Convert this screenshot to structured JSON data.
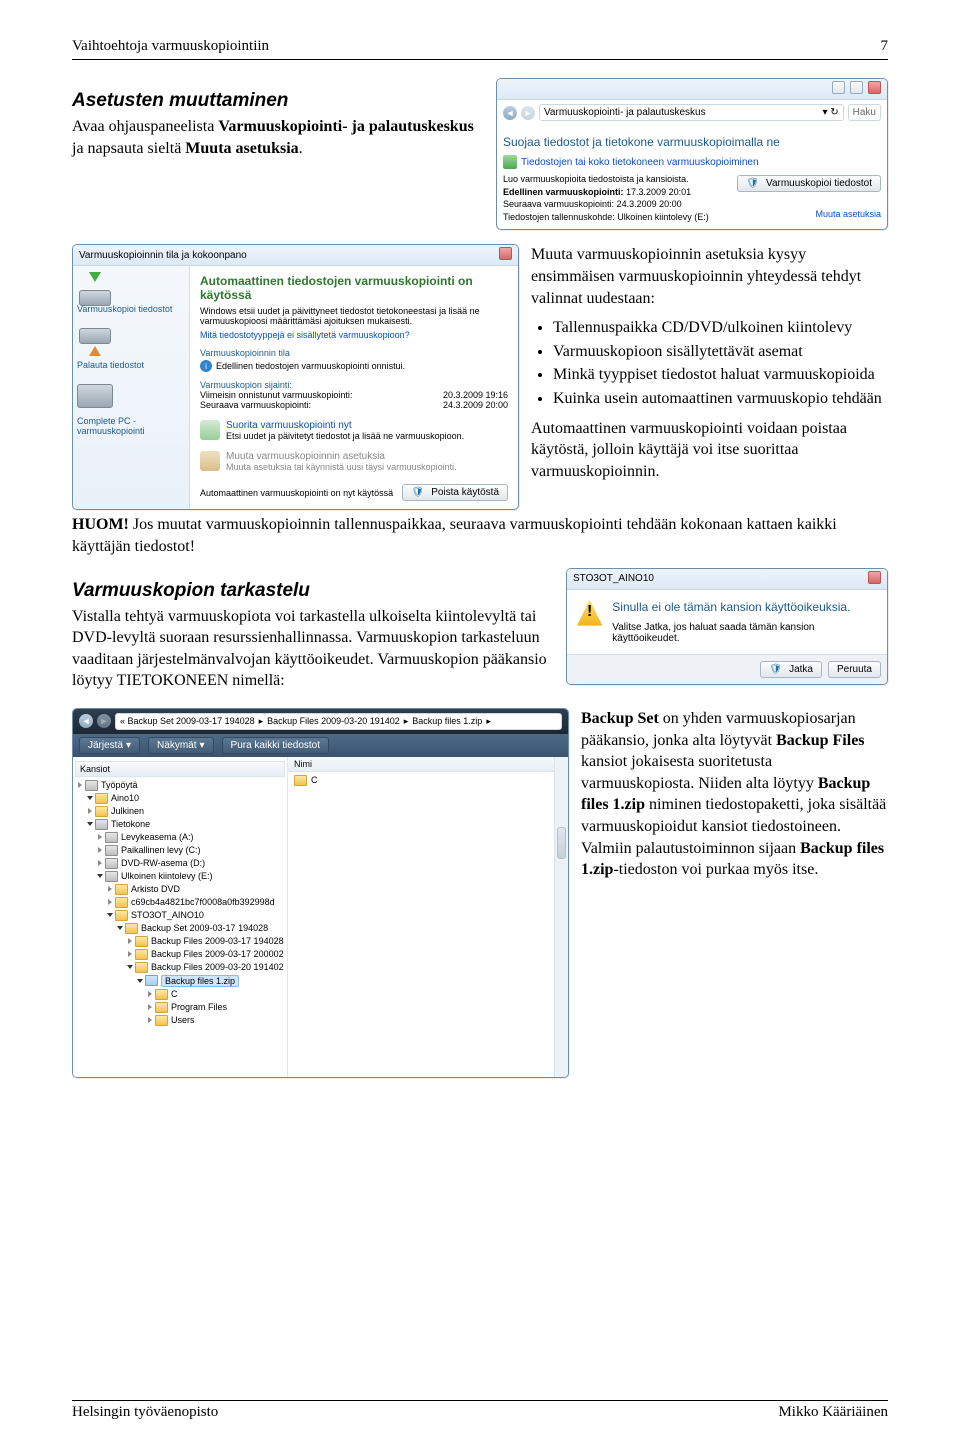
{
  "header": {
    "left": "Vaihtoehtoja varmuuskopiointiin",
    "right": "7"
  },
  "section1": {
    "title": "Asetusten muuttaminen",
    "p1a": "Avaa ohjauspaneelista ",
    "p1b": "Varmuuskopiointi- ja palautuskeskus",
    "p1c": " ja napsauta sieltä ",
    "p1d": "Muuta asetuksia",
    "p1e": "."
  },
  "panelA": {
    "crumb": "Varmuuskopiointi- ja palautuskeskus",
    "search": "Haku",
    "heading": "Suojaa tiedostot ja tietokone varmuuskopioimalla ne",
    "link1": "Tiedostojen tai koko tietokoneen varmuuskopioiminen",
    "desc": "Luo varmuuskopioita tiedostoista ja kansioista.",
    "btn": "Varmuuskopioi tiedostot",
    "row1a": "Edellinen varmuuskopiointi:",
    "row1b": "17.3.2009 20:01",
    "row2a": "Seuraava varmuuskopiointi:",
    "row2b": "24.3.2009 20:00",
    "row3a": "Tiedostojen tallennuskohde:",
    "row3b": "Ulkoinen kiintolevy (E:)",
    "link2": "Muuta asetuksia"
  },
  "panelB": {
    "title": "Varmuuskopioinnin tila ja kokoonpano",
    "side1": "Varmuuskopioi tiedostot",
    "side2": "Palauta tiedostot",
    "side3": "Complete PC -varmuuskopiointi",
    "h1": "Automaattinen tiedostojen varmuuskopiointi on käytössä",
    "d1": "Windows etsii uudet ja päivittyneet tiedostot tietokoneestasi ja lisää ne varmuuskopioosi määrittämäsi ajoituksen mukaisesti.",
    "q1": "Mitä tiedostotyyppejä ei sisällytetä varmuuskopioon?",
    "s1": "Varmuuskopioinnin tila",
    "ok": "Edellinen tiedostojen varmuuskopiointi onnistui.",
    "s2": "Varmuuskopion sijainti:",
    "r1a": "Viimeisin onnistunut varmuuskopiointi:",
    "r1b": "20.3.2009 19:16",
    "r2a": "Seuraava varmuuskopiointi:",
    "r2b": "24.3.2009 20:00",
    "run": "Suorita varmuuskopiointi nyt",
    "rund": "Etsi uudet ja päivitetyt tiedostot ja lisää ne varmuuskopioon.",
    "chg": "Muuta varmuuskopioinnin asetuksia",
    "chgd": "Muuta asetuksia tai käynnistä uusi täysi varmuuskopiointi.",
    "stat": "Automaattinen varmuuskopiointi on nyt käytössä",
    "off": "Poista käytöstä"
  },
  "rightText": {
    "p0": "Muuta varmuuskopioinnin asetuksia kysyy ensimmäisen varmuuskopioinnin yhteydessä tehdyt valinnat uudestaan:",
    "li": [
      "Tallennuspaikka CD/DVD/ulkoinen kiintolevy",
      "Varmuuskopioon sisällytettävät asemat",
      "Minkä tyyppiset tiedostot haluat varmuuskopioida",
      "Kuinka usein automaattinen varmuuskopio tehdään"
    ],
    "p1": "Automaattinen varmuuskopiointi voidaan poistaa käytöstä, jolloin käyttäjä voi itse suorittaa varmuuskopioinnin."
  },
  "huom": {
    "a": "HUOM!",
    "b": " Jos muutat varmuuskopioinnin tallennuspaikkaa, seuraava varmuuskopiointi tehdään kokonaan kattaen kaikki käyttäjän tiedostot!"
  },
  "section2": {
    "title": "Varmuuskopion tarkastelu",
    "p1": "Vistalla tehtyä varmuuskopiota voi tarkastella ulkoiselta kiintolevyltä tai DVD-levyltä suoraan resurssienhallinnassa. Varmuuskopion tarkasteluun vaaditaan järjestelmänvalvojan käyttöoikeudet. Varmuuskopion pääkansio löytyy TIETOKONEEN nimellä:"
  },
  "panelC": {
    "title": "STO3OT_AINO10",
    "msg1": "Sinulla ei ole tämän kansion käyttöoikeuksia.",
    "msg2": "Valitse Jatka, jos haluat saada tämän kansion käyttöoikeudet.",
    "btn1": "Jatka",
    "btn2": "Peruuta"
  },
  "panelD": {
    "crumbParts": [
      "« Backup Set 2009-03-17 194028",
      "Backup Files 2009-03-20 191402",
      "Backup files 1.zip"
    ],
    "tb": {
      "org": "Järjestä",
      "views": "Näkymät",
      "ext": "Pura kaikki tiedostot"
    },
    "treeHdr": "Kansiot",
    "listHdr": "Nimi",
    "tree": [
      {
        "ind": 0,
        "ico": "drive",
        "txt": "Työpöytä",
        "exp": false
      },
      {
        "ind": 1,
        "ico": "fld",
        "txt": "Aino10",
        "exp": true
      },
      {
        "ind": 1,
        "ico": "fld",
        "txt": "Julkinen",
        "exp": false
      },
      {
        "ind": 1,
        "ico": "drive",
        "txt": "Tietokone",
        "exp": true
      },
      {
        "ind": 2,
        "ico": "drive",
        "txt": "Levykeasema (A:)",
        "exp": false
      },
      {
        "ind": 2,
        "ico": "drive",
        "txt": "Paikallinen levy (C:)",
        "exp": false
      },
      {
        "ind": 2,
        "ico": "drive",
        "txt": "DVD-RW-asema (D:)",
        "exp": false
      },
      {
        "ind": 2,
        "ico": "drive",
        "txt": "Ulkoinen kiintolevy (E:)",
        "exp": true
      },
      {
        "ind": 3,
        "ico": "fld",
        "txt": "Arkisto DVD",
        "exp": false
      },
      {
        "ind": 3,
        "ico": "fld",
        "txt": "c69cb4a4821bc7f0008a0fb392998d",
        "exp": false
      },
      {
        "ind": 3,
        "ico": "fld",
        "txt": "STO3OT_AINO10",
        "exp": true
      },
      {
        "ind": 4,
        "ico": "fld",
        "txt": "Backup Set 2009-03-17 194028",
        "exp": true
      },
      {
        "ind": 5,
        "ico": "fld",
        "txt": "Backup Files 2009-03-17 194028",
        "exp": false
      },
      {
        "ind": 5,
        "ico": "fld",
        "txt": "Backup Files 2009-03-17 200002",
        "exp": false
      },
      {
        "ind": 5,
        "ico": "fld",
        "txt": "Backup Files 2009-03-20 191402",
        "exp": true
      },
      {
        "ind": 6,
        "ico": "fld",
        "txt": "Backup files 1.zip",
        "exp": true,
        "sel": true
      },
      {
        "ind": 7,
        "ico": "fld",
        "txt": "C",
        "exp": false
      },
      {
        "ind": 7,
        "ico": "fld",
        "txt": "Program Files",
        "exp": false
      },
      {
        "ind": 7,
        "ico": "fld",
        "txt": "Users",
        "exp": false
      }
    ],
    "listItem": "C"
  },
  "backupText": {
    "a": "Backup Set",
    "b": " on yhden varmuuskopiosarjan pääkansio, jonka alta löytyvät ",
    "c": "Backup Files",
    "d": " kansiot jokaisesta suoritetusta varmuuskopiosta. Niiden alta löytyy ",
    "e": "Backup files 1.zip",
    "f": " niminen tiedostopaketti, joka sisältää varmuuskopioidut kansiot tiedostoineen. Valmiin palautustoiminnon sijaan ",
    "g": "Backup files 1.zip",
    "h": "-tiedoston voi purkaa myös itse."
  },
  "footer": {
    "left": "Helsingin työväenopisto",
    "right": "Mikko Kääriäinen"
  }
}
